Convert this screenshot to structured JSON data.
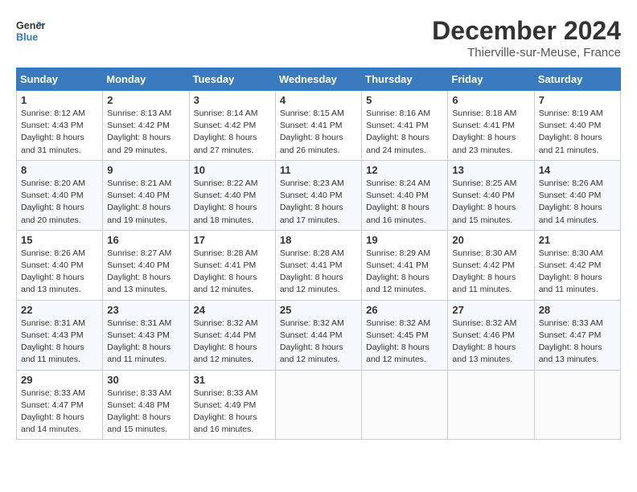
{
  "logo": {
    "line1": "General",
    "line2": "Blue"
  },
  "title": "December 2024",
  "subtitle": "Thierville-sur-Meuse, France",
  "weekdays": [
    "Sunday",
    "Monday",
    "Tuesday",
    "Wednesday",
    "Thursday",
    "Friday",
    "Saturday"
  ],
  "weeks": [
    [
      {
        "day": "1",
        "info": "Sunrise: 8:12 AM\nSunset: 4:43 PM\nDaylight: 8 hours\nand 31 minutes."
      },
      {
        "day": "2",
        "info": "Sunrise: 8:13 AM\nSunset: 4:42 PM\nDaylight: 8 hours\nand 29 minutes."
      },
      {
        "day": "3",
        "info": "Sunrise: 8:14 AM\nSunset: 4:42 PM\nDaylight: 8 hours\nand 27 minutes."
      },
      {
        "day": "4",
        "info": "Sunrise: 8:15 AM\nSunset: 4:41 PM\nDaylight: 8 hours\nand 26 minutes."
      },
      {
        "day": "5",
        "info": "Sunrise: 8:16 AM\nSunset: 4:41 PM\nDaylight: 8 hours\nand 24 minutes."
      },
      {
        "day": "6",
        "info": "Sunrise: 8:18 AM\nSunset: 4:41 PM\nDaylight: 8 hours\nand 23 minutes."
      },
      {
        "day": "7",
        "info": "Sunrise: 8:19 AM\nSunset: 4:40 PM\nDaylight: 8 hours\nand 21 minutes."
      }
    ],
    [
      {
        "day": "8",
        "info": "Sunrise: 8:20 AM\nSunset: 4:40 PM\nDaylight: 8 hours\nand 20 minutes."
      },
      {
        "day": "9",
        "info": "Sunrise: 8:21 AM\nSunset: 4:40 PM\nDaylight: 8 hours\nand 19 minutes."
      },
      {
        "day": "10",
        "info": "Sunrise: 8:22 AM\nSunset: 4:40 PM\nDaylight: 8 hours\nand 18 minutes."
      },
      {
        "day": "11",
        "info": "Sunrise: 8:23 AM\nSunset: 4:40 PM\nDaylight: 8 hours\nand 17 minutes."
      },
      {
        "day": "12",
        "info": "Sunrise: 8:24 AM\nSunset: 4:40 PM\nDaylight: 8 hours\nand 16 minutes."
      },
      {
        "day": "13",
        "info": "Sunrise: 8:25 AM\nSunset: 4:40 PM\nDaylight: 8 hours\nand 15 minutes."
      },
      {
        "day": "14",
        "info": "Sunrise: 8:26 AM\nSunset: 4:40 PM\nDaylight: 8 hours\nand 14 minutes."
      }
    ],
    [
      {
        "day": "15",
        "info": "Sunrise: 8:26 AM\nSunset: 4:40 PM\nDaylight: 8 hours\nand 13 minutes."
      },
      {
        "day": "16",
        "info": "Sunrise: 8:27 AM\nSunset: 4:40 PM\nDaylight: 8 hours\nand 13 minutes."
      },
      {
        "day": "17",
        "info": "Sunrise: 8:28 AM\nSunset: 4:41 PM\nDaylight: 8 hours\nand 12 minutes."
      },
      {
        "day": "18",
        "info": "Sunrise: 8:28 AM\nSunset: 4:41 PM\nDaylight: 8 hours\nand 12 minutes."
      },
      {
        "day": "19",
        "info": "Sunrise: 8:29 AM\nSunset: 4:41 PM\nDaylight: 8 hours\nand 12 minutes."
      },
      {
        "day": "20",
        "info": "Sunrise: 8:30 AM\nSunset: 4:42 PM\nDaylight: 8 hours\nand 11 minutes."
      },
      {
        "day": "21",
        "info": "Sunrise: 8:30 AM\nSunset: 4:42 PM\nDaylight: 8 hours\nand 11 minutes."
      }
    ],
    [
      {
        "day": "22",
        "info": "Sunrise: 8:31 AM\nSunset: 4:43 PM\nDaylight: 8 hours\nand 11 minutes."
      },
      {
        "day": "23",
        "info": "Sunrise: 8:31 AM\nSunset: 4:43 PM\nDaylight: 8 hours\nand 11 minutes."
      },
      {
        "day": "24",
        "info": "Sunrise: 8:32 AM\nSunset: 4:44 PM\nDaylight: 8 hours\nand 12 minutes."
      },
      {
        "day": "25",
        "info": "Sunrise: 8:32 AM\nSunset: 4:44 PM\nDaylight: 8 hours\nand 12 minutes."
      },
      {
        "day": "26",
        "info": "Sunrise: 8:32 AM\nSunset: 4:45 PM\nDaylight: 8 hours\nand 12 minutes."
      },
      {
        "day": "27",
        "info": "Sunrise: 8:32 AM\nSunset: 4:46 PM\nDaylight: 8 hours\nand 13 minutes."
      },
      {
        "day": "28",
        "info": "Sunrise: 8:33 AM\nSunset: 4:47 PM\nDaylight: 8 hours\nand 13 minutes."
      }
    ],
    [
      {
        "day": "29",
        "info": "Sunrise: 8:33 AM\nSunset: 4:47 PM\nDaylight: 8 hours\nand 14 minutes."
      },
      {
        "day": "30",
        "info": "Sunrise: 8:33 AM\nSunset: 4:48 PM\nDaylight: 8 hours\nand 15 minutes."
      },
      {
        "day": "31",
        "info": "Sunrise: 8:33 AM\nSunset: 4:49 PM\nDaylight: 8 hours\nand 16 minutes."
      },
      {
        "day": "",
        "info": ""
      },
      {
        "day": "",
        "info": ""
      },
      {
        "day": "",
        "info": ""
      },
      {
        "day": "",
        "info": ""
      }
    ]
  ]
}
